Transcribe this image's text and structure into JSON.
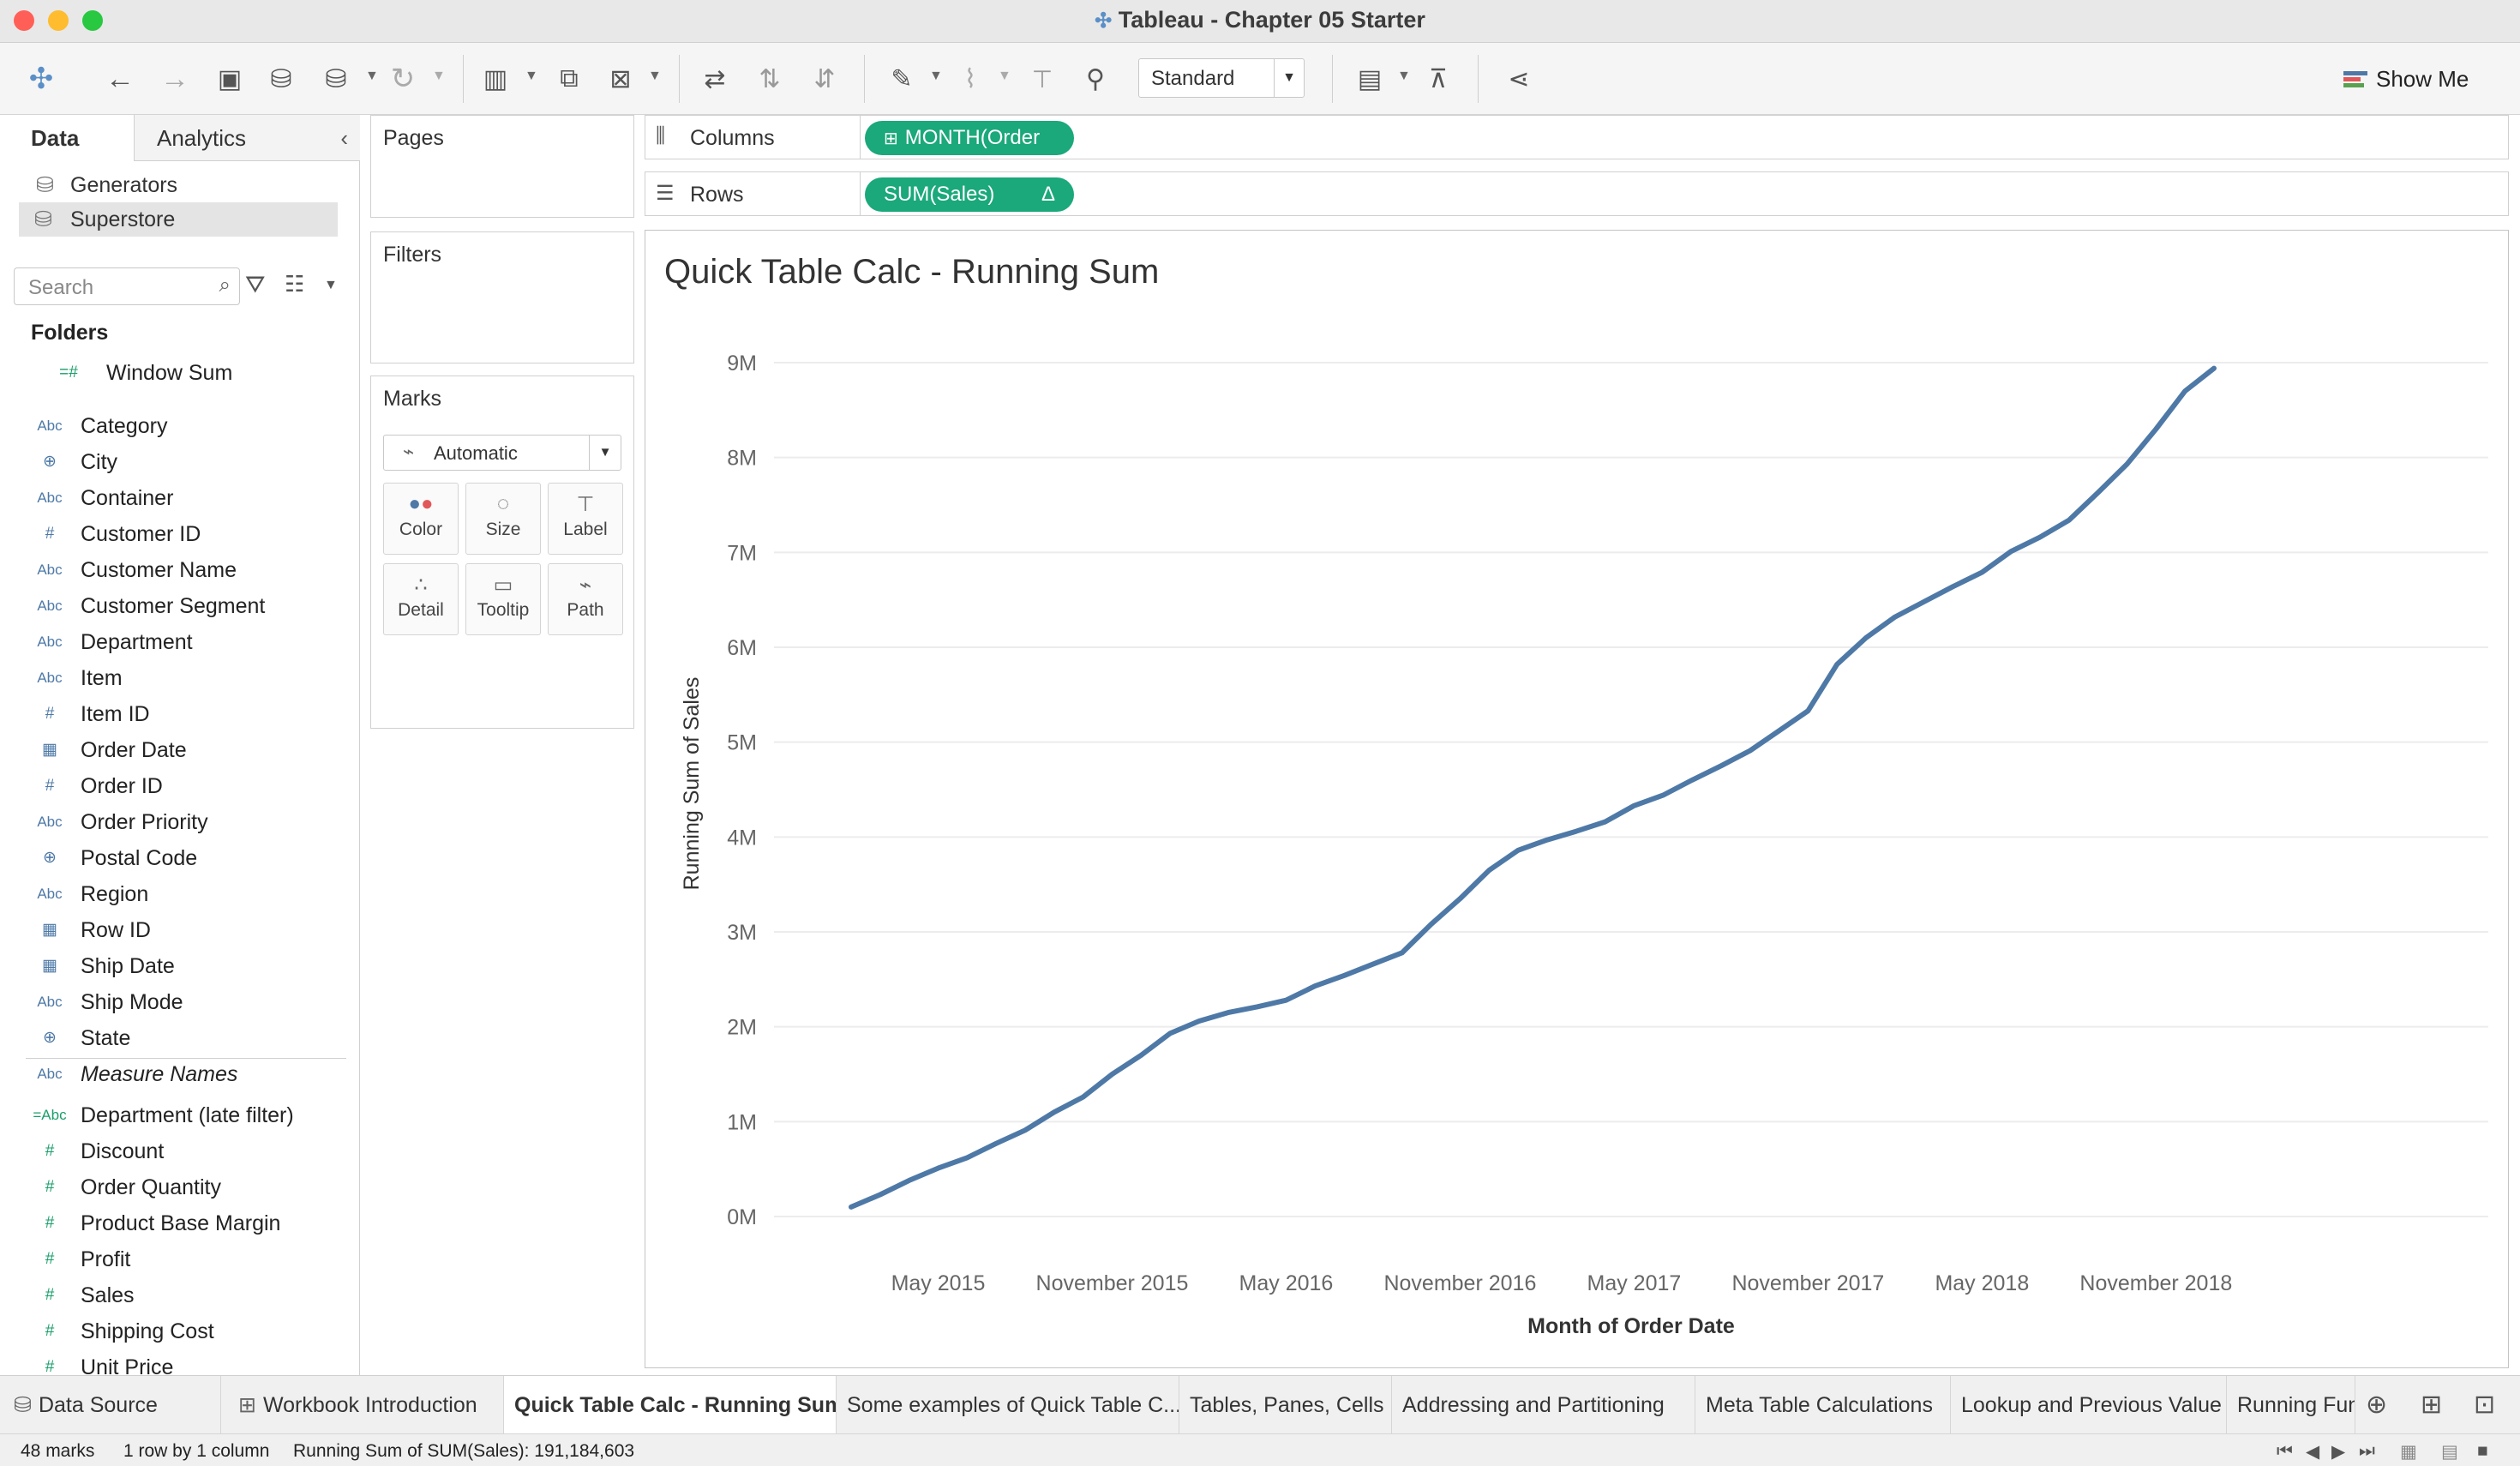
{
  "window": {
    "title": "Tableau - Chapter 05 Starter"
  },
  "toolbar": {
    "fit_mode": "Standard",
    "show_me_label": "Show Me"
  },
  "left_panel": {
    "tabs": {
      "data": "Data",
      "analytics": "Analytics"
    },
    "data_sources": [
      {
        "label": "Generators"
      },
      {
        "label": "Superstore"
      }
    ],
    "search_placeholder": "Search",
    "folders_header": "Folders",
    "fields": [
      {
        "label": "Window Sum",
        "type": "=#"
      },
      {
        "label": "Category",
        "type": "Abc"
      },
      {
        "label": "City",
        "type": "globe"
      },
      {
        "label": "Container",
        "type": "Abc"
      },
      {
        "label": "Customer ID",
        "type": "#"
      },
      {
        "label": "Customer Name",
        "type": "Abc"
      },
      {
        "label": "Customer Segment",
        "type": "Abc"
      },
      {
        "label": "Department",
        "type": "Abc"
      },
      {
        "label": "Item",
        "type": "Abc"
      },
      {
        "label": "Item ID",
        "type": "#"
      },
      {
        "label": "Order Date",
        "type": "date"
      },
      {
        "label": "Order ID",
        "type": "#"
      },
      {
        "label": "Order Priority",
        "type": "Abc"
      },
      {
        "label": "Postal Code",
        "type": "globe"
      },
      {
        "label": "Region",
        "type": "Abc"
      },
      {
        "label": "Row ID",
        "type": "date"
      },
      {
        "label": "Ship Date",
        "type": "date"
      },
      {
        "label": "Ship Mode",
        "type": "Abc"
      },
      {
        "label": "State",
        "type": "globe"
      },
      {
        "label": "Measure Names",
        "type": "Abc"
      },
      {
        "label": "Department (late filter)",
        "type": "=Abc"
      },
      {
        "label": "Discount",
        "type": "#"
      },
      {
        "label": "Order Quantity",
        "type": "#"
      },
      {
        "label": "Product Base Margin",
        "type": "#"
      },
      {
        "label": "Profit",
        "type": "#"
      },
      {
        "label": "Sales",
        "type": "#"
      },
      {
        "label": "Shipping Cost",
        "type": "#"
      },
      {
        "label": "Unit Price",
        "type": "#"
      }
    ]
  },
  "cards": {
    "pages": "Pages",
    "filters": "Filters",
    "marks": "Marks",
    "mark_type": "Automatic",
    "mark_buttons": [
      "Color",
      "Size",
      "Label",
      "Detail",
      "Tooltip",
      "Path"
    ]
  },
  "shelves": {
    "columns_label": "Columns",
    "rows_label": "Rows",
    "columns_pill": "MONTH(Order Dat..",
    "rows_pill": "SUM(Sales)",
    "rows_pill_flag": "Δ"
  },
  "chart_data": {
    "type": "line",
    "title": "Quick Table Calc - Running Sum",
    "xlabel": "Month of Order Date",
    "ylabel": "Running Sum of Sales",
    "ylim": [
      0,
      9000000
    ],
    "y_ticks": [
      "0M",
      "1M",
      "2M",
      "3M",
      "4M",
      "5M",
      "6M",
      "7M",
      "8M",
      "9M"
    ],
    "x_tick_labels": [
      "May 2015",
      "November 2015",
      "May 2016",
      "November 2016",
      "May 2017",
      "November 2017",
      "May 2018",
      "November 2018"
    ],
    "x_tick_month_index": [
      3,
      9,
      15,
      21,
      27,
      33,
      39,
      45
    ],
    "series": [
      {
        "color": "#4e79a7",
        "x_start": "January 2015",
        "values": [
          0.1,
          0.23,
          0.38,
          0.51,
          0.62,
          0.77,
          0.91,
          1.1,
          1.26,
          1.5,
          1.7,
          1.93,
          2.06,
          2.15,
          2.21,
          2.28,
          2.43,
          2.54,
          2.66,
          2.78,
          3.08,
          3.35,
          3.65,
          3.86,
          3.97,
          4.06,
          4.16,
          4.33,
          4.44,
          4.6,
          4.75,
          4.91,
          5.12,
          5.33,
          5.82,
          6.1,
          6.32,
          6.48,
          6.64,
          6.79,
          7.01,
          7.16,
          7.34,
          7.63,
          7.93,
          8.3,
          8.7,
          8.94
        ]
      }
    ],
    "grid": true
  },
  "sheet_tabs": {
    "data_source": "Data Source",
    "sheets": [
      "Workbook Introduction",
      "Quick Table Calc - Running Sum",
      "Some examples of Quick Table C...",
      "Tables, Panes, Cells",
      "Addressing and Partitioning",
      "Meta Table Calculations",
      "Lookup and Previous Value",
      "Running Fun"
    ]
  },
  "status": {
    "marks": "48 marks",
    "dims": "1 row by 1 column",
    "summary": "Running Sum of SUM(Sales): 191,184,603"
  }
}
